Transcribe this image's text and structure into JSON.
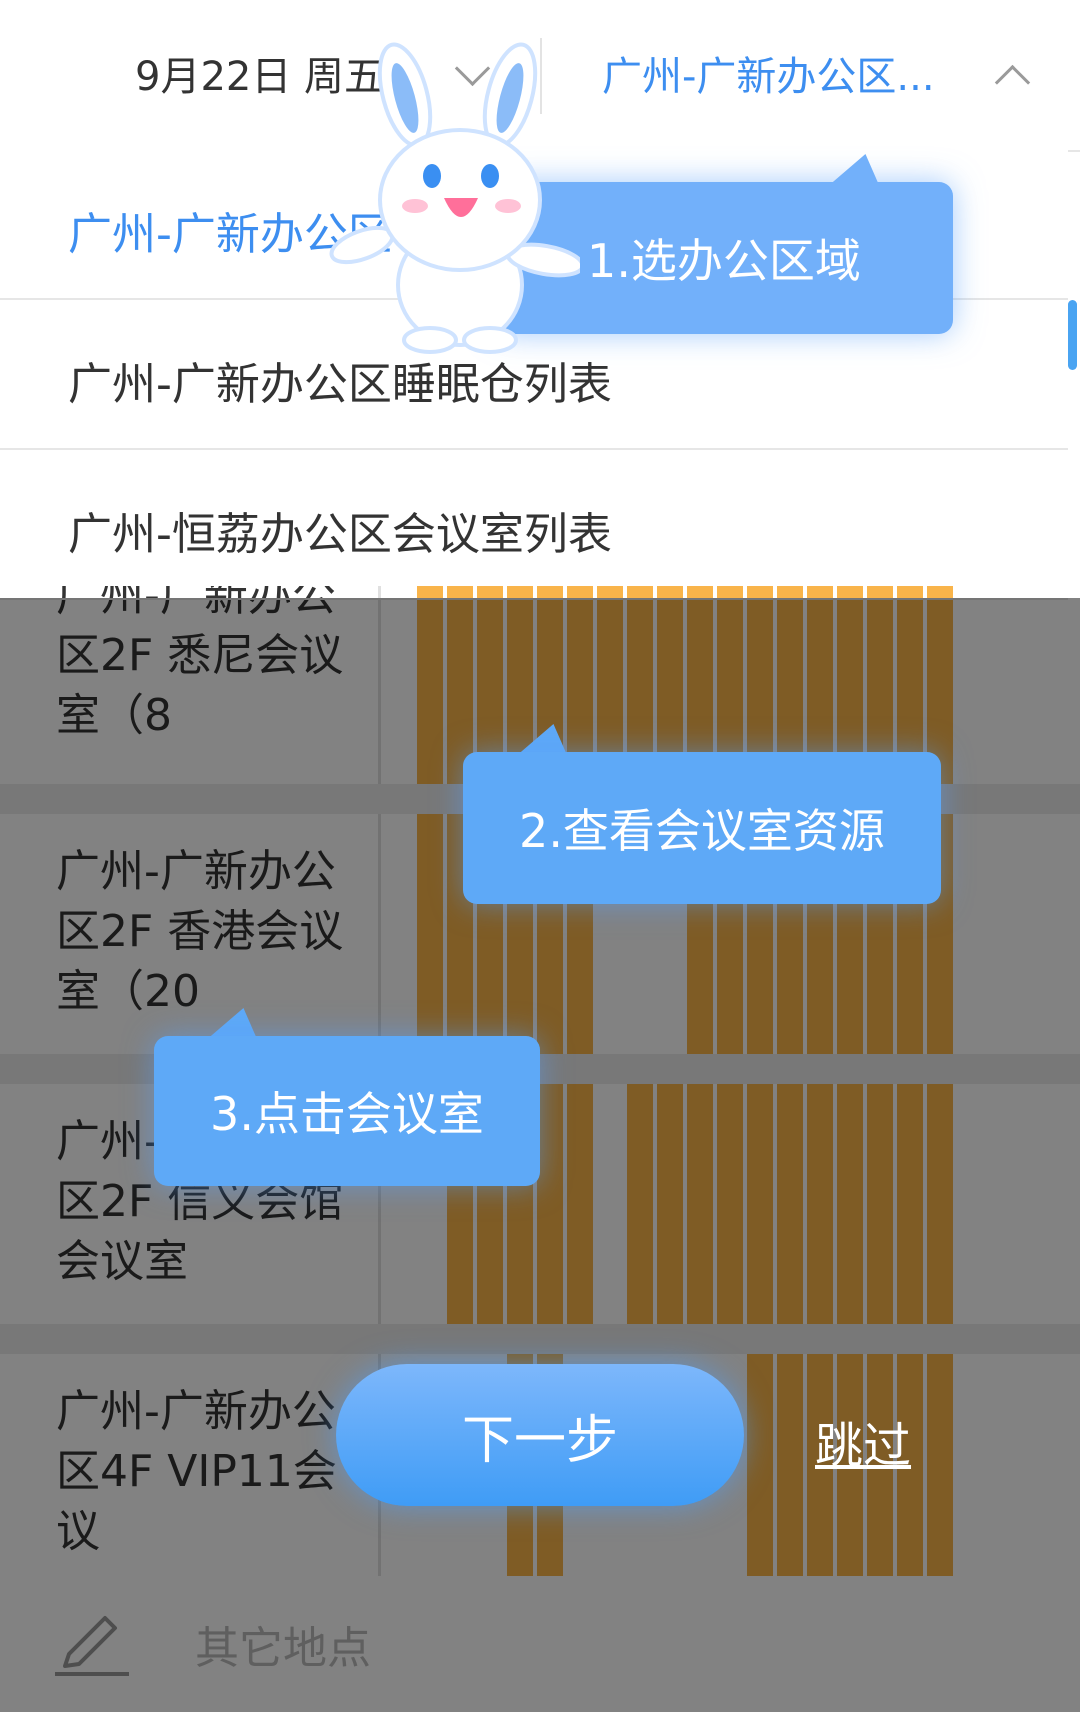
{
  "header": {
    "date": "9月22日 周五",
    "location": "广州-广新办公区..."
  },
  "dropdown": {
    "items": [
      {
        "label": "广州-广新办公区",
        "selected": true
      },
      {
        "label": "广州-广新办公区睡眠仓列表",
        "selected": false
      },
      {
        "label": "广州-恒荔办公区会议室列表",
        "selected": false
      }
    ]
  },
  "rooms": [
    {
      "label": "广州-广新办公区2F 悉尼会议室（8",
      "slots": [
        1,
        1,
        1,
        1,
        1,
        1,
        1,
        1,
        1,
        1,
        1,
        1,
        1,
        1,
        1,
        1,
        1,
        1
      ]
    },
    {
      "label": "广州-广新办公区2F 香港会议室（20",
      "slots": [
        1,
        1,
        1,
        1,
        1,
        1,
        0,
        0,
        0,
        1,
        1,
        1,
        1,
        1,
        1,
        1,
        1,
        1
      ]
    },
    {
      "label": "广州-广新办公区2F 信义会馆会议室",
      "slots": [
        0,
        1,
        1,
        1,
        1,
        1,
        0,
        1,
        1,
        1,
        1,
        1,
        1,
        1,
        1,
        1,
        1,
        1
      ]
    },
    {
      "label": "广州-广新办公区4F VIP11会议",
      "slots": [
        0,
        0,
        0,
        1,
        1,
        0,
        0,
        0,
        0,
        0,
        0,
        1,
        1,
        1,
        1,
        1,
        1,
        1
      ]
    }
  ],
  "other_place": "其它地点",
  "guide": {
    "step1": "1.选办公区域",
    "step2": "2.查看会议室资源",
    "step3": "3.点击会议室",
    "next_label": "下一步",
    "skip_label": "跳过"
  },
  "colors": {
    "accent": "#3d8ef0",
    "tooltip": "#5ea9f7",
    "busy_slot": "#f9b44a"
  }
}
